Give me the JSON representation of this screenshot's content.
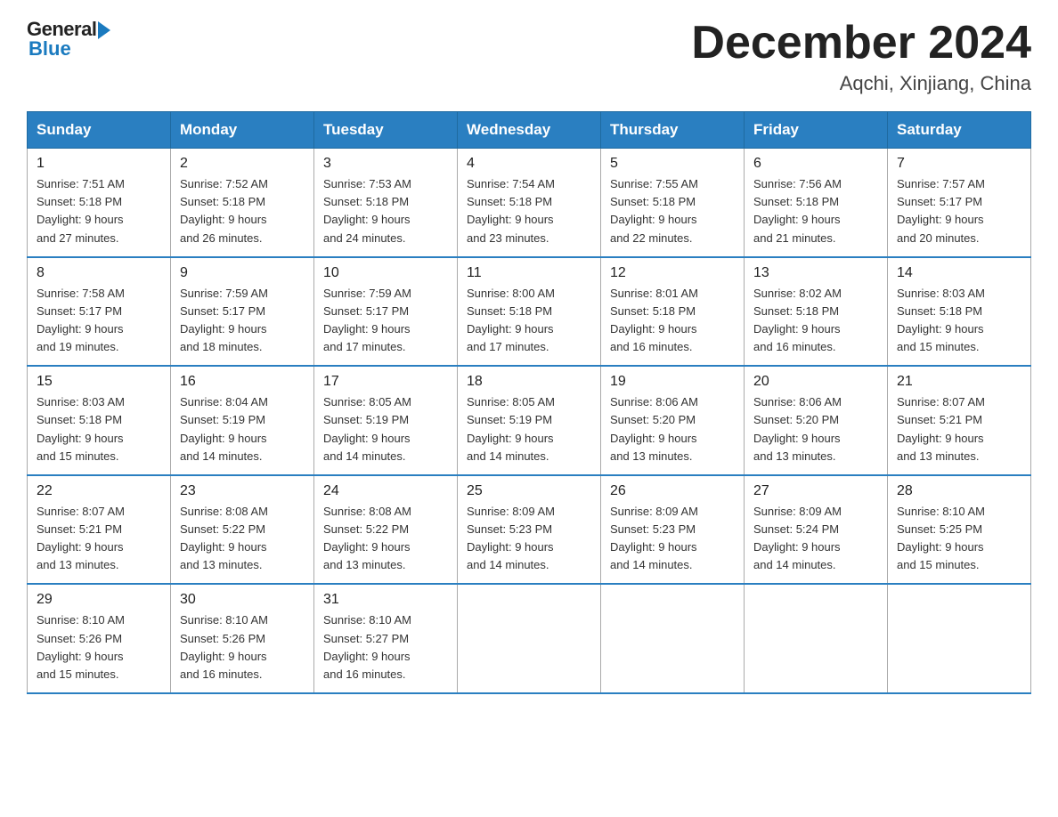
{
  "logo": {
    "general": "General",
    "blue": "Blue"
  },
  "header": {
    "month": "December 2024",
    "location": "Aqchi, Xinjiang, China"
  },
  "weekdays": [
    "Sunday",
    "Monday",
    "Tuesday",
    "Wednesday",
    "Thursday",
    "Friday",
    "Saturday"
  ],
  "weeks": [
    [
      {
        "day": "1",
        "sunrise": "7:51 AM",
        "sunset": "5:18 PM",
        "daylight": "9 hours and 27 minutes."
      },
      {
        "day": "2",
        "sunrise": "7:52 AM",
        "sunset": "5:18 PM",
        "daylight": "9 hours and 26 minutes."
      },
      {
        "day": "3",
        "sunrise": "7:53 AM",
        "sunset": "5:18 PM",
        "daylight": "9 hours and 24 minutes."
      },
      {
        "day": "4",
        "sunrise": "7:54 AM",
        "sunset": "5:18 PM",
        "daylight": "9 hours and 23 minutes."
      },
      {
        "day": "5",
        "sunrise": "7:55 AM",
        "sunset": "5:18 PM",
        "daylight": "9 hours and 22 minutes."
      },
      {
        "day": "6",
        "sunrise": "7:56 AM",
        "sunset": "5:18 PM",
        "daylight": "9 hours and 21 minutes."
      },
      {
        "day": "7",
        "sunrise": "7:57 AM",
        "sunset": "5:17 PM",
        "daylight": "9 hours and 20 minutes."
      }
    ],
    [
      {
        "day": "8",
        "sunrise": "7:58 AM",
        "sunset": "5:17 PM",
        "daylight": "9 hours and 19 minutes."
      },
      {
        "day": "9",
        "sunrise": "7:59 AM",
        "sunset": "5:17 PM",
        "daylight": "9 hours and 18 minutes."
      },
      {
        "day": "10",
        "sunrise": "7:59 AM",
        "sunset": "5:17 PM",
        "daylight": "9 hours and 17 minutes."
      },
      {
        "day": "11",
        "sunrise": "8:00 AM",
        "sunset": "5:18 PM",
        "daylight": "9 hours and 17 minutes."
      },
      {
        "day": "12",
        "sunrise": "8:01 AM",
        "sunset": "5:18 PM",
        "daylight": "9 hours and 16 minutes."
      },
      {
        "day": "13",
        "sunrise": "8:02 AM",
        "sunset": "5:18 PM",
        "daylight": "9 hours and 16 minutes."
      },
      {
        "day": "14",
        "sunrise": "8:03 AM",
        "sunset": "5:18 PM",
        "daylight": "9 hours and 15 minutes."
      }
    ],
    [
      {
        "day": "15",
        "sunrise": "8:03 AM",
        "sunset": "5:18 PM",
        "daylight": "9 hours and 15 minutes."
      },
      {
        "day": "16",
        "sunrise": "8:04 AM",
        "sunset": "5:19 PM",
        "daylight": "9 hours and 14 minutes."
      },
      {
        "day": "17",
        "sunrise": "8:05 AM",
        "sunset": "5:19 PM",
        "daylight": "9 hours and 14 minutes."
      },
      {
        "day": "18",
        "sunrise": "8:05 AM",
        "sunset": "5:19 PM",
        "daylight": "9 hours and 14 minutes."
      },
      {
        "day": "19",
        "sunrise": "8:06 AM",
        "sunset": "5:20 PM",
        "daylight": "9 hours and 13 minutes."
      },
      {
        "day": "20",
        "sunrise": "8:06 AM",
        "sunset": "5:20 PM",
        "daylight": "9 hours and 13 minutes."
      },
      {
        "day": "21",
        "sunrise": "8:07 AM",
        "sunset": "5:21 PM",
        "daylight": "9 hours and 13 minutes."
      }
    ],
    [
      {
        "day": "22",
        "sunrise": "8:07 AM",
        "sunset": "5:21 PM",
        "daylight": "9 hours and 13 minutes."
      },
      {
        "day": "23",
        "sunrise": "8:08 AM",
        "sunset": "5:22 PM",
        "daylight": "9 hours and 13 minutes."
      },
      {
        "day": "24",
        "sunrise": "8:08 AM",
        "sunset": "5:22 PM",
        "daylight": "9 hours and 13 minutes."
      },
      {
        "day": "25",
        "sunrise": "8:09 AM",
        "sunset": "5:23 PM",
        "daylight": "9 hours and 14 minutes."
      },
      {
        "day": "26",
        "sunrise": "8:09 AM",
        "sunset": "5:23 PM",
        "daylight": "9 hours and 14 minutes."
      },
      {
        "day": "27",
        "sunrise": "8:09 AM",
        "sunset": "5:24 PM",
        "daylight": "9 hours and 14 minutes."
      },
      {
        "day": "28",
        "sunrise": "8:10 AM",
        "sunset": "5:25 PM",
        "daylight": "9 hours and 15 minutes."
      }
    ],
    [
      {
        "day": "29",
        "sunrise": "8:10 AM",
        "sunset": "5:26 PM",
        "daylight": "9 hours and 15 minutes."
      },
      {
        "day": "30",
        "sunrise": "8:10 AM",
        "sunset": "5:26 PM",
        "daylight": "9 hours and 16 minutes."
      },
      {
        "day": "31",
        "sunrise": "8:10 AM",
        "sunset": "5:27 PM",
        "daylight": "9 hours and 16 minutes."
      },
      null,
      null,
      null,
      null
    ]
  ],
  "labels": {
    "sunrise": "Sunrise: ",
    "sunset": "Sunset: ",
    "daylight": "Daylight: "
  }
}
